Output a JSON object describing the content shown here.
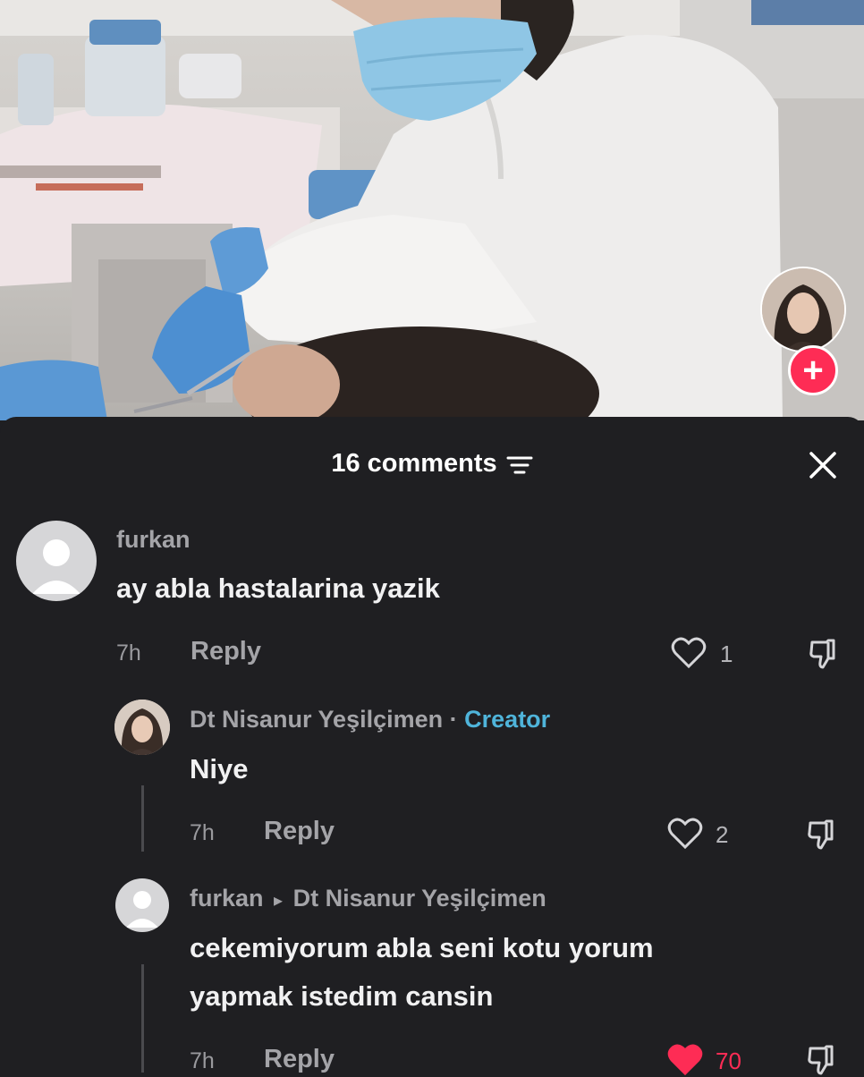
{
  "video": {
    "follow_label": "+"
  },
  "header": {
    "comments_count_label": "16 comments"
  },
  "comments": [
    {
      "username": "furkan",
      "text": "ay abla hastalarina yazik",
      "time": "7h",
      "reply_label": "Reply",
      "likes": "1",
      "liked": false
    },
    {
      "username": "Dt Nisanur Yeşilçimen",
      "separator": "·",
      "badge": "Creator",
      "text": "Niye",
      "time": "7h",
      "reply_label": "Reply",
      "likes": "2",
      "liked": false
    },
    {
      "username": "furkan",
      "reply_to_arrow": "▸",
      "reply_to": "Dt Nisanur Yeşilçimen",
      "text_line1": "cekemiyorum abla seni kotu yorum",
      "text_line2": "yapmak istedim cansin",
      "time": "7h",
      "reply_label": "Reply",
      "likes": "70",
      "liked": true
    }
  ],
  "colors": {
    "sheet_background": "#1f1f22",
    "creator_badge": "#4fb4da",
    "like_active": "#fe2c55",
    "follow_button": "#fe2c55"
  }
}
